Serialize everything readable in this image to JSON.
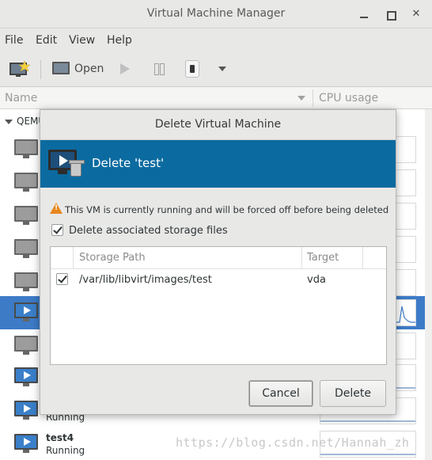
{
  "window": {
    "title": "Virtual Machine Manager"
  },
  "menu": [
    "File",
    "Edit",
    "View",
    "Help"
  ],
  "toolbar": {
    "open_label": "Open"
  },
  "list": {
    "col_name": "Name",
    "col_cpu": "CPU usage",
    "group": "QEMU",
    "rows": [
      {
        "name": "",
        "status": ""
      },
      {
        "name": "",
        "status": ""
      },
      {
        "name": "",
        "status": ""
      },
      {
        "name": "",
        "status": ""
      },
      {
        "name": "",
        "status": ""
      },
      {
        "name": "",
        "status": ""
      },
      {
        "name": "",
        "status": ""
      },
      {
        "name": "",
        "status": ""
      },
      {
        "name": "",
        "status": "Running"
      },
      {
        "name": "test4",
        "status": "Running"
      }
    ]
  },
  "dialog": {
    "title": "Delete Virtual Machine",
    "banner": "Delete 'test'",
    "warning": "This VM is currently running and will be forced off before being deleted",
    "delete_storage_label": "Delete associated storage files",
    "storage_headers": {
      "path": "Storage Path",
      "target": "Target"
    },
    "storage_rows": [
      {
        "path": "/var/lib/libvirt/images/test",
        "target": "vda"
      }
    ],
    "cancel_label": "Cancel",
    "delete_label": "Delete"
  },
  "watermark": "https://blog.csdn.net/Hannah_zh",
  "colors": {
    "banner": "#0b6ba0",
    "selection": "#3d7bc7",
    "warning": "#e8861c"
  },
  "icons": [
    "new-vm-icon",
    "monitor-icon",
    "run-icon",
    "pause-icon",
    "shutdown-icon",
    "dropdown-icon",
    "warning-icon",
    "delete-vm-icon",
    "checkbox-icon"
  ]
}
